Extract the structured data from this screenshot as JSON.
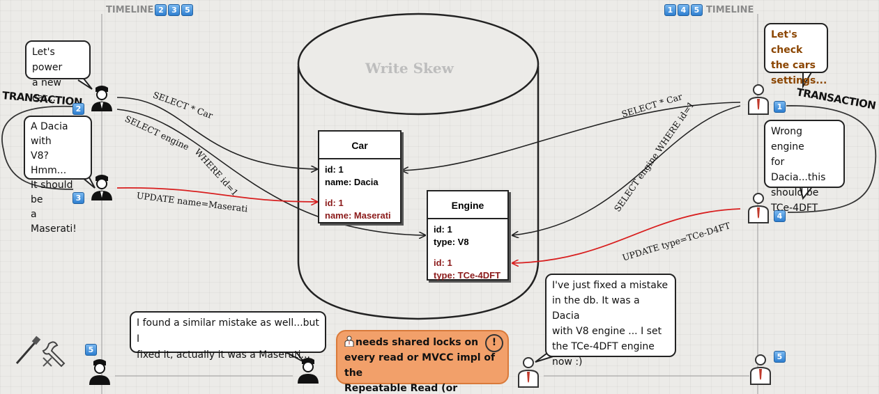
{
  "timeline_left": {
    "label": "TIMELINE",
    "steps": [
      "2",
      "3",
      "5"
    ]
  },
  "timeline_right": {
    "label": "TIMELINE",
    "steps": [
      "1",
      "4",
      "5"
    ]
  },
  "database": {
    "title": "Write Skew"
  },
  "car_table": {
    "name": "Car",
    "original": [
      "id: 1",
      "name: Dacia"
    ],
    "updated": [
      "id: 1",
      "name: Maserati"
    ]
  },
  "engine_table": {
    "name": "Engine",
    "original": [
      "id: 1",
      "type: V8"
    ],
    "updated": [
      "id: 1",
      "type: TCe-4DFT"
    ]
  },
  "left_transaction": {
    "title": "TRANSACTION",
    "bubble_power": [
      "Let's power",
      "a new car..."
    ],
    "bubble_dacia": [
      "A Dacia with",
      "V8? Hmm...",
      "It should be",
      "a Maserati!"
    ],
    "step_select": "2",
    "step_update": "3",
    "select_car": "SELECT * Car",
    "select_engine": "SELECT engine",
    "where": "WHERE id=1",
    "update": "UPDATE name=Maserati"
  },
  "right_transaction": {
    "title": "TRANSACTION",
    "bubble_check": [
      "Let's check",
      "the cars",
      "settings..."
    ],
    "bubble_wrong": [
      "Wrong engine",
      "for Dacia...this",
      "should be",
      "TCe-4DFT"
    ],
    "step_select": "1",
    "step_update": "4",
    "select_car": "SELECT * Car",
    "select_engine": "SELECT engine WHERE id=1",
    "update": "UPDATE type=TCe-D4FT"
  },
  "bottom": {
    "left_bubble": [
      "I found a similar mistake as well...but I",
      "fixed it, actually it was a Maserati..."
    ],
    "right_bubble": [
      "I've just fixed a mistake",
      "in the db. It was a Dacia",
      "with V8 engine ... I set",
      "the TCe-4DFT engine",
      "now :)"
    ],
    "step_left": "5",
    "step_right": "5",
    "note": [
      "needs shared locks on",
      "every read or MVCC impl of the",
      "Repeatable Read (or Serializable)"
    ],
    "note_prefix_icon": "manager-icon",
    "note_alert_icon": "alert-icon"
  },
  "colors": {
    "update_arrow": "#d81e1e",
    "note_bg": "#f2a06a",
    "timeline": "#8a8a8a",
    "updated_text": "#8b1a1a"
  }
}
